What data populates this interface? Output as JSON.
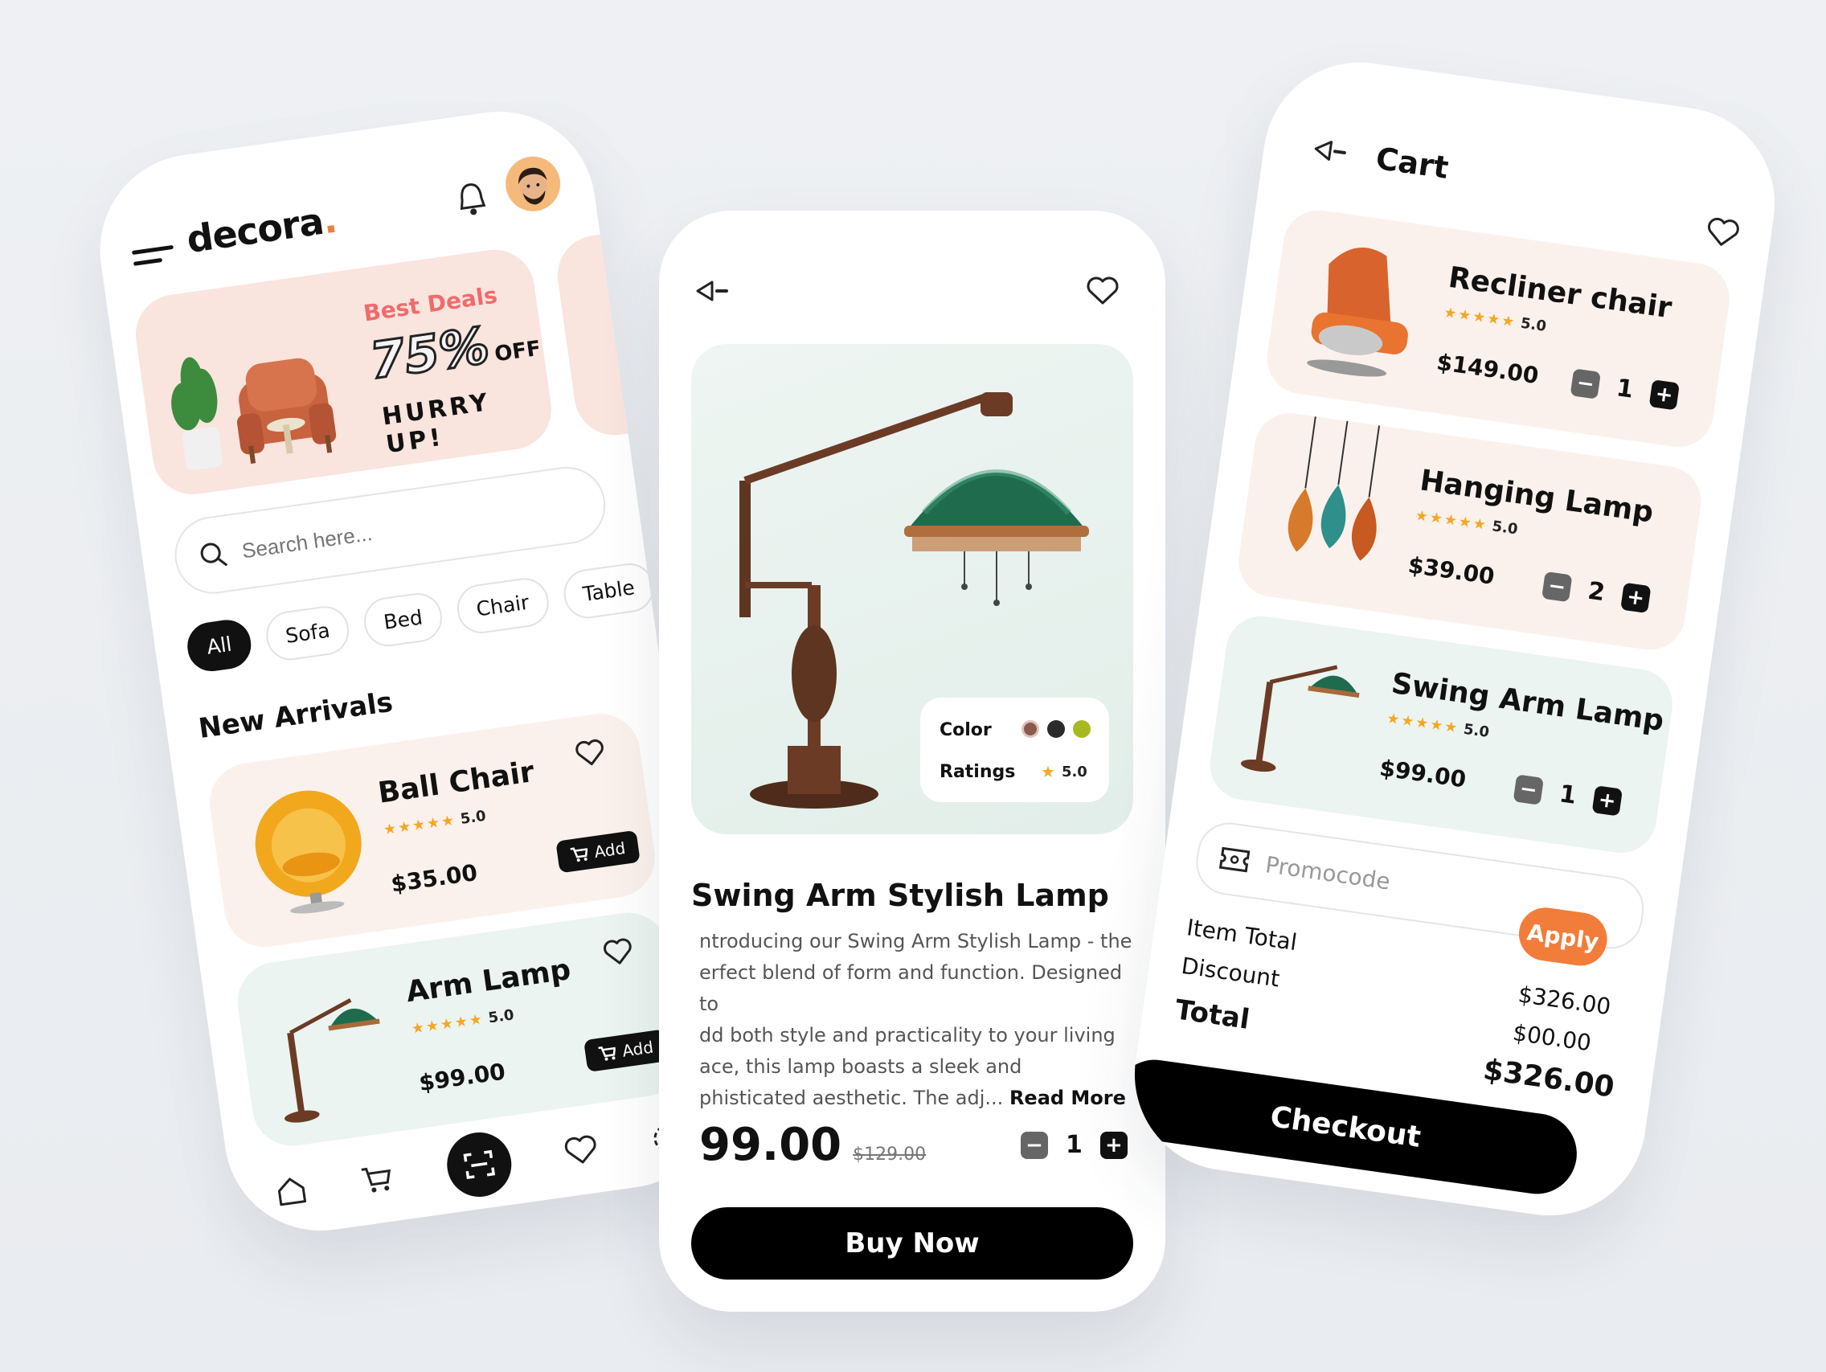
{
  "home": {
    "logo_text": "decora",
    "logo_dot": ".",
    "banner": {
      "title": "Best Deals",
      "percent": "75%",
      "off": "OFF",
      "hurry": "HURRY UP!"
    },
    "search_placeholder": "Search here...",
    "categories": [
      "All",
      "Sofa",
      "Bed",
      "Chair",
      "Table"
    ],
    "section_title": "New Arrivals",
    "products": [
      {
        "name": "Ball Chair",
        "rating": "5.0",
        "price": "$35.00",
        "add_label": "Add"
      },
      {
        "name": "Arm Lamp",
        "rating": "5.0",
        "price": "$99.00",
        "add_label": "Add"
      }
    ]
  },
  "detail": {
    "color_label": "Color",
    "colors": [
      "#8a5a4e",
      "#2b2b2b",
      "#a8b820"
    ],
    "ratings_label": "Ratings",
    "rating": "5.0",
    "title": "Swing Arm Stylish Lamp",
    "description_lines": [
      "ntroducing our Swing Arm Stylish Lamp - the",
      "erfect blend of form and function. Designed to",
      "dd both style and practicality to your living",
      "ace, this lamp boasts a sleek and",
      "phisticated aesthetic. The adj..."
    ],
    "read_more": "Read More",
    "price": "99.00",
    "old_price": "$129.00",
    "quantity": "1",
    "buy_label": "Buy Now"
  },
  "cart": {
    "title": "Cart",
    "items": [
      {
        "name": "Recliner chair",
        "rating": "5.0",
        "price": "$149.00",
        "qty": "1"
      },
      {
        "name": "Hanging Lamp",
        "rating": "5.0",
        "price": "$39.00",
        "qty": "2"
      },
      {
        "name": "Swing Arm Lamp",
        "rating": "5.0",
        "price": "$99.00",
        "qty": "1"
      }
    ],
    "promo_placeholder": "Promocode",
    "apply_label": "Apply",
    "item_total_label": "Item Total",
    "discount_label": "Discount",
    "total_label": "Total",
    "item_total": "$326.00",
    "discount": "$00.00",
    "total": "$326.00",
    "checkout_label": "Checkout"
  },
  "accent_color": "#f27d3a"
}
